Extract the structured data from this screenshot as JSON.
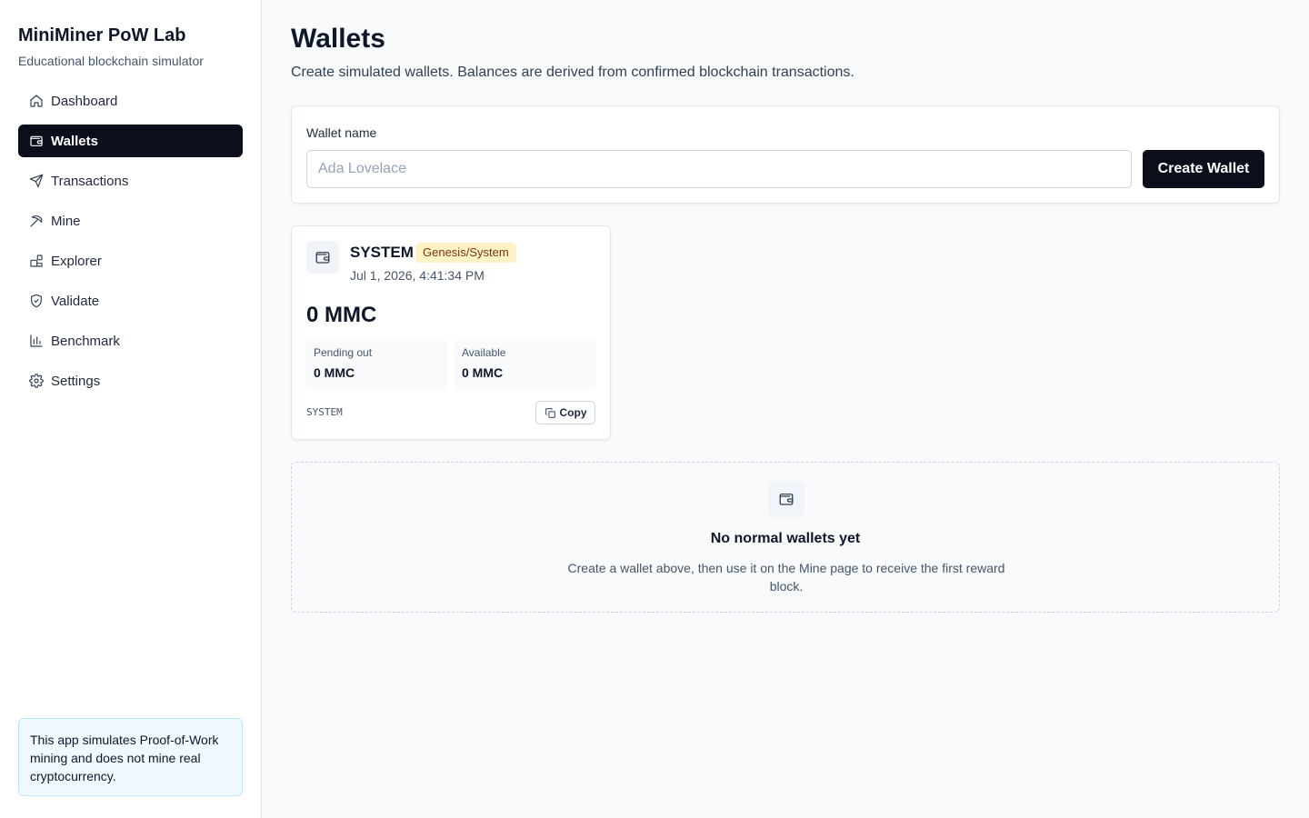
{
  "brand": {
    "title": "MiniMiner PoW Lab",
    "subtitle": "Educational blockchain simulator"
  },
  "nav": [
    {
      "label": "Dashboard",
      "icon": "home-icon",
      "active": false
    },
    {
      "label": "Wallets",
      "icon": "wallet-icon",
      "active": true
    },
    {
      "label": "Transactions",
      "icon": "send-icon",
      "active": false
    },
    {
      "label": "Mine",
      "icon": "pickaxe-icon",
      "active": false
    },
    {
      "label": "Explorer",
      "icon": "blocks-icon",
      "active": false
    },
    {
      "label": "Validate",
      "icon": "shield-check-icon",
      "active": false
    },
    {
      "label": "Benchmark",
      "icon": "bar-chart-icon",
      "active": false
    },
    {
      "label": "Settings",
      "icon": "gear-icon",
      "active": false
    }
  ],
  "notice": "This app simulates Proof-of-Work mining and does not mine real cryptocurrency.",
  "page": {
    "title": "Wallets",
    "description": "Create simulated wallets. Balances are derived from confirmed blockchain transactions."
  },
  "create_form": {
    "label": "Wallet name",
    "placeholder": "Ada Lovelace",
    "value": "",
    "button_label": "Create Wallet"
  },
  "wallet": {
    "name": "SYSTEM",
    "badge": "Genesis/System",
    "created": "Jul 1, 2026, 4:41:34 PM",
    "balance": "0 MMC",
    "pending_label": "Pending out",
    "pending_value": "0 MMC",
    "available_label": "Available",
    "available_value": "0 MMC",
    "address": "SYSTEM",
    "copy_label": "Copy"
  },
  "empty_state": {
    "title": "No normal wallets yet",
    "description": "Create a wallet above, then use it on the Mine page to receive the first reward block."
  },
  "colors": {
    "accent": "#0b0f1c",
    "badge_bg": "#fef3c7",
    "notice_bg": "#f0f9ff"
  }
}
